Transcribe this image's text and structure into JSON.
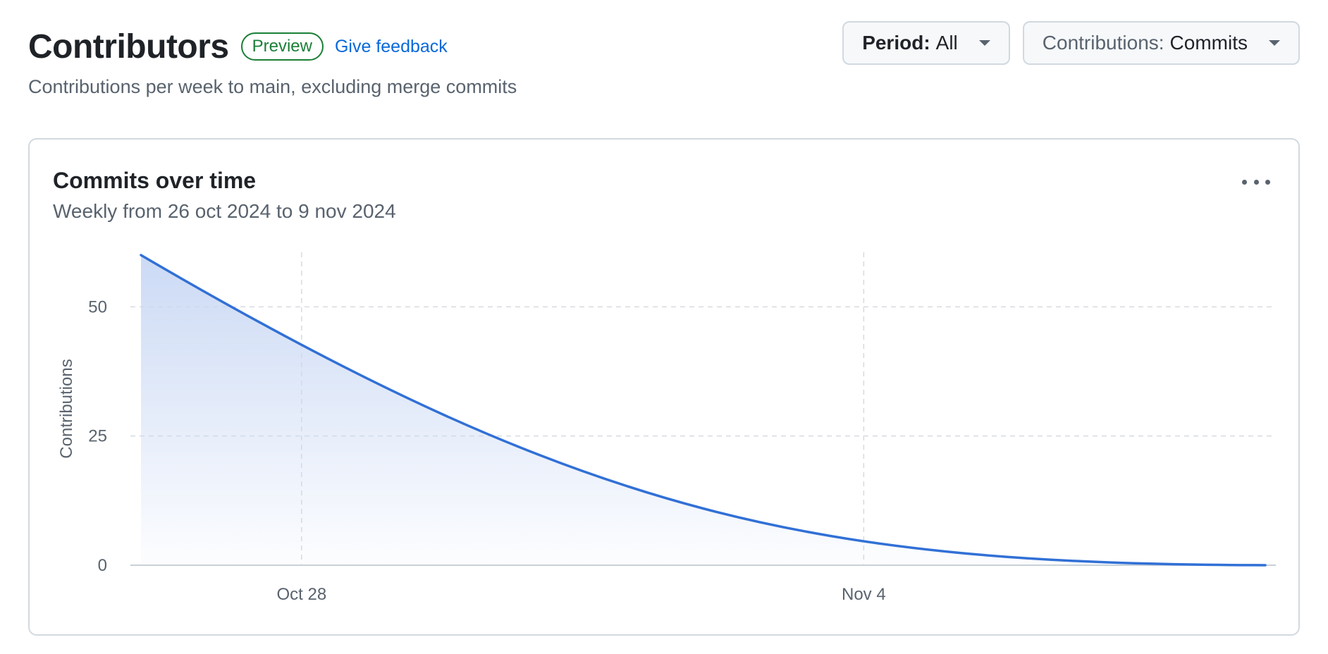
{
  "header": {
    "title": "Contributors",
    "badge": "Preview",
    "feedback_link": "Give feedback",
    "subtitle": "Contributions per week to main, excluding merge commits"
  },
  "controls": {
    "period": {
      "key": "Period:",
      "value": "All"
    },
    "contributions": {
      "key": "Contributions:",
      "value": "Commits"
    }
  },
  "card": {
    "title": "Commits over time",
    "subtitle": "Weekly from 26 oct 2024 to 9 nov 2024",
    "more_icon": "kebab-horizontal-icon"
  },
  "colors": {
    "line": "#3170d6",
    "area_top": "#c9d8f4",
    "grid": "#d6dbe1",
    "badge": "#1a7f37",
    "link": "#0969da"
  },
  "chart_data": {
    "type": "area",
    "ylabel": "Contributions",
    "xlabel": "",
    "ylim": [
      0,
      60
    ],
    "yticks": [
      0,
      25,
      50
    ],
    "x": [
      "2024-10-26",
      "2024-11-09"
    ],
    "xticks": [
      {
        "date": "2024-10-28",
        "label": "Oct 28"
      },
      {
        "date": "2024-11-04",
        "label": "Nov 4"
      }
    ],
    "series": [
      {
        "values": [
          60,
          0
        ]
      }
    ],
    "grid": true
  }
}
